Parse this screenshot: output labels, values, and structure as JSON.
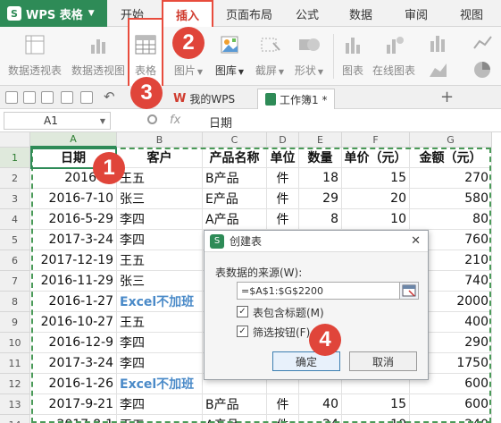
{
  "app": {
    "logo_text": "WPS 表格",
    "tabs": [
      "开始",
      "插入",
      "页面布局",
      "公式",
      "数据",
      "审阅",
      "视图"
    ],
    "active_tab": "插入"
  },
  "ribbon": {
    "buttons": [
      "数据透视表",
      "数据透视图",
      "表格",
      "图片",
      "图库",
      "截屏",
      "形状",
      "图表",
      "在线图表"
    ]
  },
  "doc_tabs": {
    "home": "我的WPS",
    "workbook": "工作簿1 *"
  },
  "formula_bar": {
    "cell_ref": "A1",
    "fx": "fx",
    "value": "日期"
  },
  "sheet": {
    "columns": [
      "A",
      "B",
      "C",
      "D",
      "E",
      "F",
      "G"
    ],
    "rows": [
      "1",
      "2",
      "3",
      "4",
      "5",
      "6",
      "7",
      "8",
      "9",
      "10",
      "11",
      "12",
      "13",
      "14"
    ],
    "headers": [
      "日期",
      "客户",
      "产品名称",
      "单位",
      "数量",
      "单价（元）",
      "金额（元）"
    ],
    "data": [
      [
        "2016-2-",
        "王五",
        "B产品",
        "件",
        "18",
        "15",
        "270"
      ],
      [
        "2016-7-10",
        "张三",
        "E产品",
        "件",
        "29",
        "20",
        "580"
      ],
      [
        "2016-5-29",
        "李四",
        "A产品",
        "件",
        "8",
        "10",
        "80"
      ],
      [
        "2017-3-24",
        "李四",
        "",
        "",
        "",
        "",
        "760"
      ],
      [
        "2017-12-19",
        "王五",
        "",
        "",
        "",
        "",
        "210"
      ],
      [
        "2016-11-29",
        "张三",
        "",
        "",
        "",
        "",
        "740"
      ],
      [
        "2016-1-27",
        "Excel不加班",
        "",
        "",
        "",
        "",
        "2000"
      ],
      [
        "2016-10-27",
        "王五",
        "",
        "",
        "",
        "",
        "400"
      ],
      [
        "2016-12-9",
        "李四",
        "",
        "",
        "",
        "",
        "290"
      ],
      [
        "2017-3-24",
        "李四",
        "",
        "",
        "",
        "",
        "1750"
      ],
      [
        "2016-1-26",
        "Excel不加班",
        "",
        "",
        "",
        "",
        "600"
      ],
      [
        "2017-9-21",
        "李四",
        "B产品",
        "件",
        "40",
        "15",
        "600"
      ],
      [
        "2017-8-1",
        "王五",
        "A产品",
        "件",
        "24",
        "10",
        "240"
      ]
    ]
  },
  "dialog": {
    "title": "创建表",
    "close": "✕",
    "source_label": "表数据的来源(W):",
    "range": "=$A$1:$G$2200",
    "has_header": "表包含标题(M)",
    "filter_btn": "筛选按钮(F)",
    "ok": "确定",
    "cancel": "取消"
  },
  "steps": [
    "1",
    "2",
    "3",
    "4"
  ],
  "colors": {
    "wps_green": "#2e8b57",
    "accent_red": "#e0453a",
    "link_blue": "#4a8ac8"
  }
}
